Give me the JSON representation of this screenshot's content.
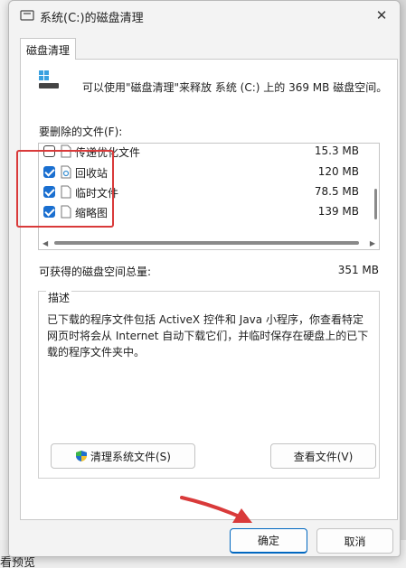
{
  "window": {
    "title": "系统(C:)的磁盘清理",
    "close_glyph": "✕"
  },
  "tab": {
    "label": "磁盘清理"
  },
  "intro_text": "可以使用\"磁盘清理\"来释放 系统 (C:) 上的 369 MB 磁盘空间。",
  "files_label": "要删除的文件(F):",
  "files": [
    {
      "name": "传递优化文件",
      "size": "15.3 MB",
      "checked": false,
      "icon": "file-icon"
    },
    {
      "name": "回收站",
      "size": "120 MB",
      "checked": true,
      "icon": "recycle-bin-icon"
    },
    {
      "name": "临时文件",
      "size": "78.5 MB",
      "checked": true,
      "icon": "file-icon"
    },
    {
      "name": "缩略图",
      "size": "139 MB",
      "checked": true,
      "icon": "file-icon"
    }
  ],
  "total_label": "可获得的磁盘空间总量:",
  "total_value": "351 MB",
  "description": {
    "title": "描述",
    "text": "已下载的程序文件包括 ActiveX 控件和 Java 小程序，你查看特定网页时将会从 Internet 自动下载它们，并临时保存在硬盘上的已下载的程序文件夹中。"
  },
  "buttons": {
    "clean_system": "清理系统文件(S)",
    "view_files": "查看文件(V)",
    "ok": "确定",
    "cancel": "取消"
  },
  "background_fragment": "看预览",
  "colors": {
    "accent": "#0067c0",
    "checkbox": "#1a6fd0",
    "annotation_red": "#d93a3a"
  }
}
